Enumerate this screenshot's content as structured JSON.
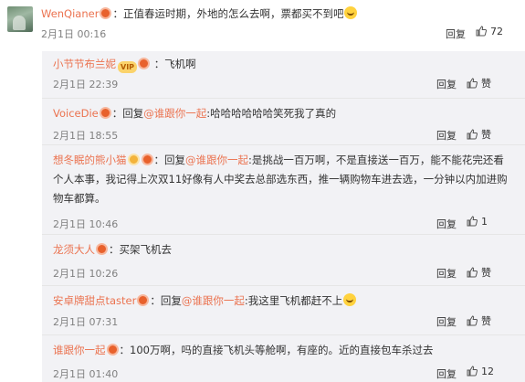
{
  "main": {
    "username": "WenQianer",
    "text": "：正值春运时期，外地的怎么去啊，票都买不到吧",
    "time": "2月1日 00:16",
    "reply_label": "回复",
    "likes": "72"
  },
  "replies": [
    {
      "username": "小节节布兰妮",
      "parts": [
        {
          "t": "：飞机啊"
        }
      ],
      "time": "2月1日 22:39",
      "reply_label": "回复",
      "likes": "赞"
    },
    {
      "username": "VoiceDie",
      "parts": [
        {
          "t": "：回复"
        },
        {
          "at": "@谁跟你一起"
        },
        {
          "t": ":哈哈哈哈哈哈笑死我了真的"
        }
      ],
      "time": "2月1日 18:55",
      "reply_label": "回复",
      "likes": "赞"
    },
    {
      "username": "想冬眠的熊小猫",
      "parts": [
        {
          "t": "：回复"
        },
        {
          "at": "@谁跟你一起"
        },
        {
          "t": ":是挑战一百万啊，不是直接送一百万，能不能花完还看个人本事，我记得上次双11好像有人中奖去总部选东西，推一辆购物车进去选，一分钟以内加进购物车都算。"
        }
      ],
      "time": "2月1日 10:46",
      "reply_label": "回复",
      "likes": "1"
    },
    {
      "username": "龙须大人",
      "parts": [
        {
          "t": "：买架飞机去"
        }
      ],
      "time": "2月1日 10:26",
      "reply_label": "回复",
      "likes": "赞"
    },
    {
      "username": "安卓牌甜点taster",
      "parts": [
        {
          "t": "：回复"
        },
        {
          "at": "@谁跟你一起"
        },
        {
          "t": ":我这里飞机都赶不上"
        }
      ],
      "time": "2月1日 07:31",
      "reply_label": "回复",
      "likes": "赞"
    },
    {
      "username": "谁跟你一起",
      "parts": [
        {
          "t": "：100万啊，吗的直接飞机头等舱啊，有座的。近的直接包车杀过去"
        }
      ],
      "time": "2月1日 01:40",
      "reply_label": "回复",
      "likes": "12"
    }
  ]
}
